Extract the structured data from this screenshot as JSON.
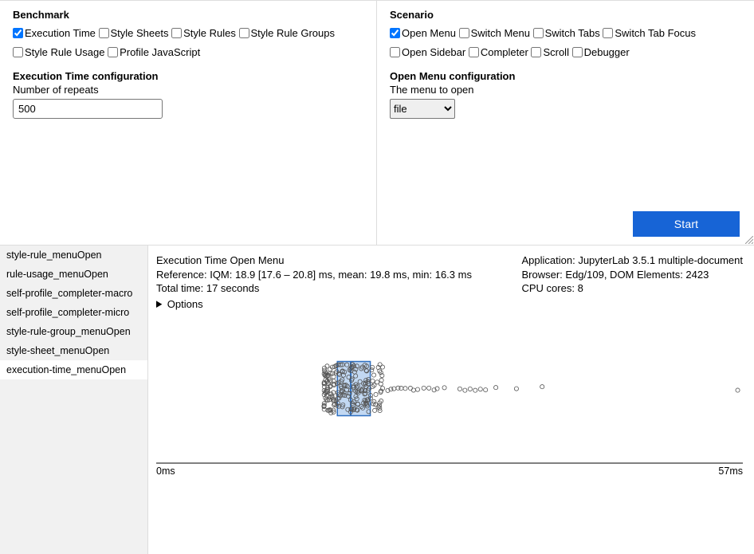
{
  "benchmark": {
    "title": "Benchmark",
    "items": [
      {
        "label": "Execution Time",
        "checked": true
      },
      {
        "label": "Style Sheets",
        "checked": false
      },
      {
        "label": "Style Rules",
        "checked": false
      },
      {
        "label": "Style Rule Groups",
        "checked": false
      },
      {
        "label": "Style Rule Usage",
        "checked": false
      },
      {
        "label": "Profile JavaScript",
        "checked": false
      }
    ],
    "config_title": "Execution Time configuration",
    "config_sub": "Number of repeats",
    "config_value": "500"
  },
  "scenario": {
    "title": "Scenario",
    "items": [
      {
        "label": "Open Menu",
        "checked": true
      },
      {
        "label": "Switch Menu",
        "checked": false
      },
      {
        "label": "Switch Tabs",
        "checked": false
      },
      {
        "label": "Switch Tab Focus",
        "checked": false
      },
      {
        "label": "Open Sidebar",
        "checked": false
      },
      {
        "label": "Completer",
        "checked": false
      },
      {
        "label": "Scroll",
        "checked": false
      },
      {
        "label": "Debugger",
        "checked": false
      }
    ],
    "config_title": "Open Menu configuration",
    "config_sub": "The menu to open",
    "config_value": "file"
  },
  "start_label": "Start",
  "sidebar": {
    "items": [
      "style-rule_menuOpen",
      "rule-usage_menuOpen",
      "self-profile_completer-macro",
      "self-profile_completer-micro",
      "style-rule-group_menuOpen",
      "style-sheet_menuOpen",
      "execution-time_menuOpen"
    ],
    "selected_index": 6
  },
  "results": {
    "title": "Execution Time Open Menu",
    "reference": "Reference: IQM: 18.9 [17.6 – 20.8] ms, mean: 19.8 ms, min: 16.3 ms",
    "total_time": "Total time: 17 seconds",
    "app": "Application: JupyterLab 3.5.1 multiple-document",
    "browser": "Browser: Edg/109, DOM Elements: 2423",
    "cpu": "CPU cores: 8",
    "options_label": "Options"
  },
  "chart_data": {
    "type": "boxplot_with_scatter",
    "title": "",
    "xlabel": "ms",
    "ylabel": "",
    "xlim": [
      0,
      57
    ],
    "axis_ticks": {
      "x_min_label": "0ms",
      "x_max_label": "57ms"
    },
    "box": {
      "q1": 17.6,
      "median": 18.9,
      "q3": 20.8,
      "whisker_low": 16.3,
      "whisker_high": 21.5,
      "color": "#4f90d9"
    },
    "dense_cluster_range": [
      16.3,
      22
    ],
    "scatter_outliers_x": [
      22.5,
      22.8,
      23.1,
      23.5,
      23.8,
      24.2,
      24.7,
      25.0,
      25.4,
      26.0,
      26.5,
      27.0,
      27.3,
      28.0,
      29.5,
      30.0,
      30.5,
      31.0,
      31.5,
      32.0,
      33.0,
      35.0,
      37.5,
      56.5
    ],
    "n": 500
  }
}
